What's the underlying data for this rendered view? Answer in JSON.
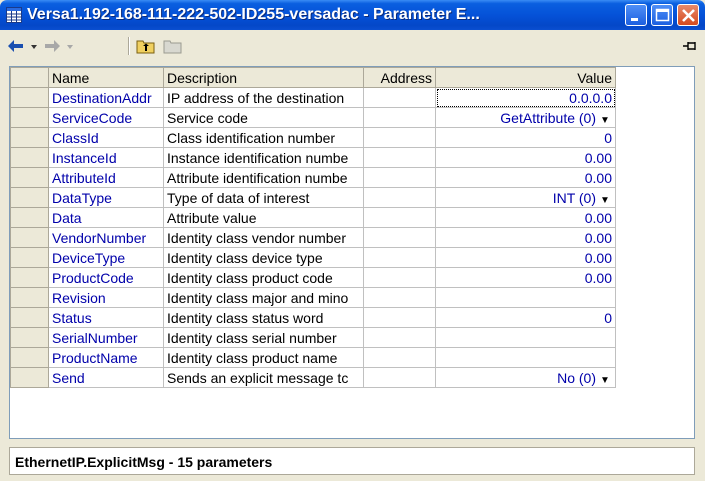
{
  "window": {
    "title": "Versa1.192-168-111-222-502-ID255-versadac - Parameter E...",
    "colors": {
      "titlebar": "#0552d8",
      "value_text": "#0000aa",
      "name_text": "#0000aa"
    }
  },
  "toolbar": {
    "back_icon": "back-arrow-icon",
    "forward_icon": "forward-arrow-icon",
    "up_folder_icon": "up-folder-icon",
    "folder_icon": "folder-icon",
    "pin_icon": "pin-icon"
  },
  "grid": {
    "headers": {
      "name": "Name",
      "description": "Description",
      "address": "Address",
      "value": "Value"
    },
    "rows": [
      {
        "name": "DestinationAddr",
        "description": "IP address of the destination",
        "address": "",
        "value": "0.0.0.0",
        "dropdown": false
      },
      {
        "name": "ServiceCode",
        "description": "Service code",
        "address": "",
        "value": "GetAttribute (0)",
        "dropdown": true
      },
      {
        "name": "ClassId",
        "description": "Class identification number",
        "address": "",
        "value": "0",
        "dropdown": false
      },
      {
        "name": "InstanceId",
        "description": "Instance identification numbe",
        "address": "",
        "value": "0.00",
        "dropdown": false
      },
      {
        "name": "AttributeId",
        "description": "Attribute identification numbe",
        "address": "",
        "value": "0.00",
        "dropdown": false
      },
      {
        "name": "DataType",
        "description": "Type of data of interest",
        "address": "",
        "value": "INT (0)",
        "dropdown": true
      },
      {
        "name": "Data",
        "description": "Attribute value",
        "address": "",
        "value": "0.00",
        "dropdown": false
      },
      {
        "name": "VendorNumber",
        "description": "Identity class vendor number",
        "address": "",
        "value": "0.00",
        "dropdown": false
      },
      {
        "name": "DeviceType",
        "description": "Identity class device type",
        "address": "",
        "value": "0.00",
        "dropdown": false
      },
      {
        "name": "ProductCode",
        "description": "Identity class product code",
        "address": "",
        "value": "0.00",
        "dropdown": false
      },
      {
        "name": "Revision",
        "description": "Identity class major and mino",
        "address": "",
        "value": "",
        "dropdown": false
      },
      {
        "name": "Status",
        "description": "Identity class status word",
        "address": "",
        "value": "0",
        "dropdown": false
      },
      {
        "name": "SerialNumber",
        "description": "Identity class serial number",
        "address": "",
        "value": "",
        "dropdown": false
      },
      {
        "name": "ProductName",
        "description": "Identity class product name",
        "address": "",
        "value": "",
        "dropdown": false
      },
      {
        "name": "Send",
        "description": "Sends an explicit message tc",
        "address": "",
        "value": "No (0)",
        "dropdown": true
      }
    ]
  },
  "status": {
    "text": "EthernetIP.ExplicitMsg  -  15 parameters"
  }
}
